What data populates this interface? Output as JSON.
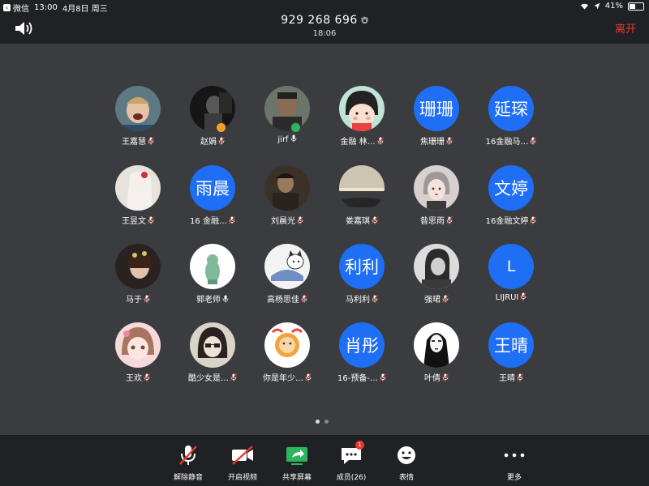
{
  "status_bar": {
    "back_app": "微信",
    "time": "13:00",
    "date": "4月8日 周三",
    "battery": "41%",
    "battery_level": 0.41
  },
  "header": {
    "meeting_id": "929 268 696",
    "elapsed": "18:06",
    "leave_label": "离开"
  },
  "participants": [
    {
      "name": "王嘉慧",
      "avatar_text": "",
      "avatar_kind": "photo-kid",
      "mic": "muted"
    },
    {
      "name": "赵娟",
      "avatar_text": "",
      "avatar_kind": "photo-dark",
      "mic": "muted",
      "badge": "host"
    },
    {
      "name": "jirf",
      "avatar_text": "",
      "avatar_kind": "photo-man",
      "mic": "on",
      "badge": "cohost"
    },
    {
      "name": "金融 林…",
      "avatar_text": "",
      "avatar_kind": "cartoon-girl",
      "mic": "muted"
    },
    {
      "name": "焦珊珊",
      "avatar_text": "珊珊",
      "avatar_kind": "text",
      "mic": "muted"
    },
    {
      "name": "16金融马…",
      "avatar_text": "延琛",
      "avatar_kind": "text",
      "mic": "muted"
    },
    {
      "name": "王昱文",
      "avatar_text": "",
      "avatar_kind": "photo-bride",
      "mic": "muted"
    },
    {
      "name": "16 金融…",
      "avatar_text": "雨晨",
      "avatar_kind": "text",
      "mic": "muted"
    },
    {
      "name": "刘晨光",
      "avatar_text": "",
      "avatar_kind": "photo-actor",
      "mic": "muted"
    },
    {
      "name": "娄嘉琪",
      "avatar_text": "",
      "avatar_kind": "photo-sunset",
      "mic": "muted"
    },
    {
      "name": "昝思雨",
      "avatar_text": "",
      "avatar_kind": "drawing-girl",
      "mic": "muted"
    },
    {
      "name": "16金融文婷",
      "avatar_text": "文婷",
      "avatar_kind": "text",
      "mic": "muted"
    },
    {
      "name": "马于",
      "avatar_text": "",
      "avatar_kind": "photo-woman",
      "mic": "muted"
    },
    {
      "name": "郭老师",
      "avatar_text": "",
      "avatar_kind": "cartoon-green",
      "mic": "on"
    },
    {
      "name": "高杨思佳",
      "avatar_text": "",
      "avatar_kind": "cartoon-cat",
      "mic": "muted"
    },
    {
      "name": "马利利",
      "avatar_text": "利利",
      "avatar_kind": "text",
      "mic": "muted"
    },
    {
      "name": "强珺",
      "avatar_text": "",
      "avatar_kind": "photo-bw",
      "mic": "muted"
    },
    {
      "name": "LIJRUI",
      "avatar_text": "L",
      "avatar_kind": "text",
      "mic": "muted"
    },
    {
      "name": "王欢",
      "avatar_text": "",
      "avatar_kind": "anime-pink",
      "mic": "muted"
    },
    {
      "name": "酷少女是…",
      "avatar_text": "",
      "avatar_kind": "anime-dark",
      "mic": "muted"
    },
    {
      "name": "你是年少…",
      "avatar_text": "",
      "avatar_kind": "cartoon-lion",
      "mic": "muted"
    },
    {
      "name": "16-预备-…",
      "avatar_text": "肖彤",
      "avatar_kind": "text",
      "mic": "muted"
    },
    {
      "name": "叶倩",
      "avatar_text": "",
      "avatar_kind": "noface",
      "mic": "muted"
    },
    {
      "name": "王晴",
      "avatar_text": "王晴",
      "avatar_kind": "text",
      "mic": "muted"
    }
  ],
  "toolbar": {
    "unmute_label": "解除静音",
    "start_video_label": "开启视频",
    "share_screen_label": "共享屏幕",
    "members_label": "成员(26)",
    "members_badge": "1",
    "reactions_label": "表情",
    "more_label": "更多"
  },
  "pager": {
    "pages": 2,
    "current": 1
  },
  "colors": {
    "background": "#3a3c3f",
    "bar": "#202124",
    "accent_blue": "#1e6ff5",
    "leave_red": "#e8392f",
    "share_green": "#2db55d",
    "muted_red": "#e8392f"
  }
}
